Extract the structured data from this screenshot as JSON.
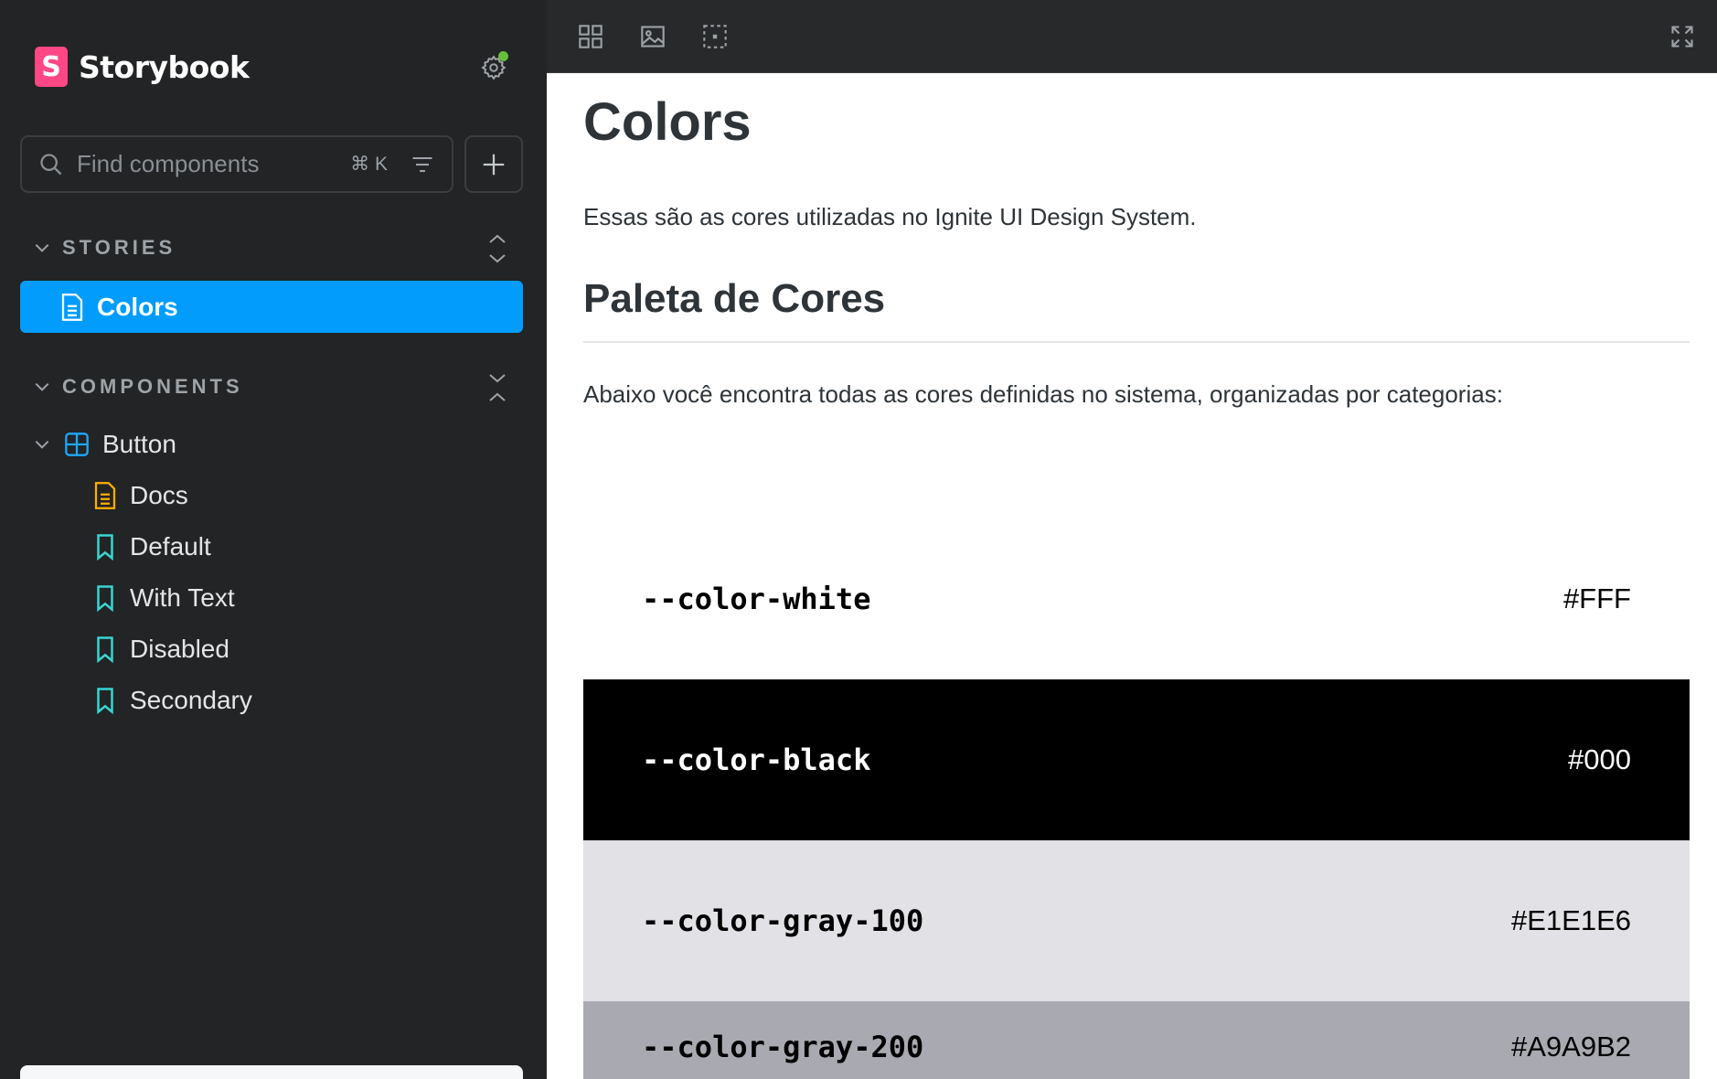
{
  "brand": {
    "name": "Storybook",
    "logo_letter": "S",
    "accent": "#ff4785"
  },
  "search": {
    "placeholder": "Find components",
    "shortcut": "⌘ K"
  },
  "sidebar": {
    "stories_section": "STORIES",
    "components_section": "COMPONENTS",
    "selected_item": "Colors",
    "selected_color": "#029cfd",
    "tree": [
      {
        "label": "Button",
        "icon": "component-icon"
      },
      {
        "label": "Docs",
        "icon": "document-icon"
      },
      {
        "label": "Default",
        "icon": "bookmark-icon"
      },
      {
        "label": "With Text",
        "icon": "bookmark-icon"
      },
      {
        "label": "Disabled",
        "icon": "bookmark-icon"
      },
      {
        "label": "Secondary",
        "icon": "bookmark-icon"
      }
    ]
  },
  "toolbar": {
    "icons": [
      "grid-icon",
      "image-icon",
      "outline-icon",
      "fullscreen-icon"
    ]
  },
  "main": {
    "title": "Colors",
    "intro": "Essas são as cores utilizadas no Ignite UI Design System.",
    "subtitle": "Paleta de Cores",
    "description": "Abaixo você encontra todas as cores definidas no sistema, organizadas por categorias:",
    "colors": [
      {
        "name": "--color-white",
        "hex": "#FFF",
        "bg": "#ffffff",
        "fg": "#000000"
      },
      {
        "name": "--color-black",
        "hex": "#000",
        "bg": "#000000",
        "fg": "#ffffff"
      },
      {
        "name": "--color-gray-100",
        "hex": "#E1E1E6",
        "bg": "#e1e1e6",
        "fg": "#000000"
      },
      {
        "name": "--color-gray-200",
        "hex": "#A9A9B2",
        "bg": "#a9a9b2",
        "fg": "#000000"
      }
    ]
  }
}
